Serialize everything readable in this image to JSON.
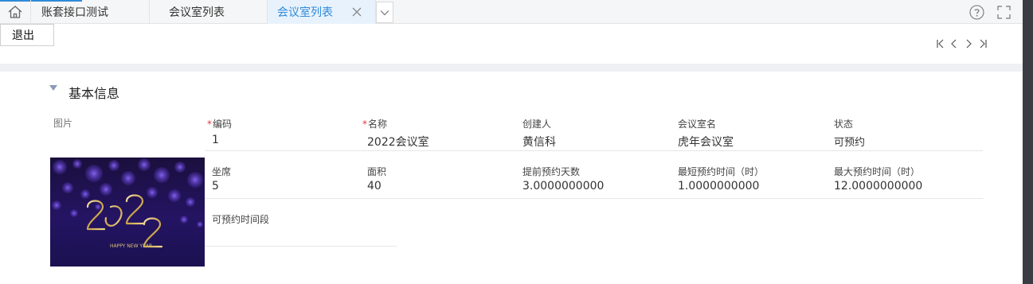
{
  "tabs": [
    {
      "label": "账套接口测试",
      "active": false
    },
    {
      "label": "会议室列表",
      "active": false
    },
    {
      "label": "会议室列表",
      "active": true
    }
  ],
  "toolbar": {
    "exit_label": "退出"
  },
  "pager_icons": [
    "first-page-icon",
    "prev-page-icon",
    "next-page-icon",
    "last-page-icon"
  ],
  "section": {
    "title": "基本信息"
  },
  "form": {
    "image_label": "图片",
    "image_text": {
      "year_top": "20",
      "year_bottom": "22",
      "tagline": "HAPPY NEW YEAR"
    },
    "fields": [
      {
        "label": "编码",
        "required": true,
        "value": "1"
      },
      {
        "label": "名称",
        "required": true,
        "value": "2022会议室"
      },
      {
        "label": "创建人",
        "required": false,
        "value": "黄信科"
      },
      {
        "label": "会议室名",
        "required": false,
        "value": "虎年会议室"
      },
      {
        "label": "状态",
        "required": false,
        "value": "可预约"
      },
      {
        "label": "坐席",
        "required": false,
        "value": "5"
      },
      {
        "label": "面积",
        "required": false,
        "value": "40"
      },
      {
        "label": "提前预约天数",
        "required": false,
        "value": "3.0000000000"
      },
      {
        "label": "最短预约时间（时）",
        "required": false,
        "value": "1.0000000000"
      },
      {
        "label": "最大预约时间（时）",
        "required": false,
        "value": "12.0000000000"
      },
      {
        "label": "可预约时间段",
        "required": false,
        "value": ""
      }
    ]
  },
  "colors": {
    "accent": "#2f8bd9",
    "required": "#e0383e",
    "separator": "#eef0f4"
  }
}
